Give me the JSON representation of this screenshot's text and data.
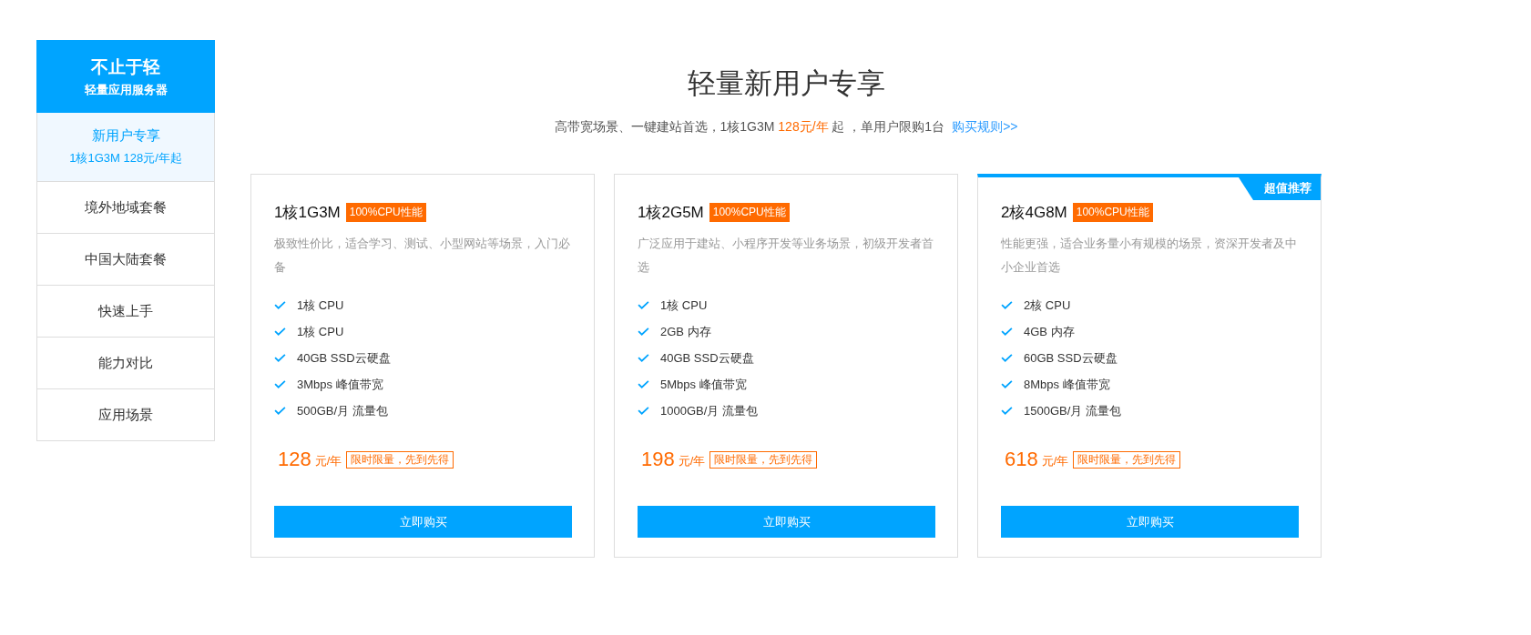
{
  "sidebar": {
    "title": "不止于轻",
    "subtitle": "轻量应用服务器",
    "items": [
      {
        "label": "新用户专享",
        "sub": "1核1G3M 128元/年起",
        "selected": true
      },
      {
        "label": "境外地域套餐",
        "selected": false
      },
      {
        "label": "中国大陆套餐",
        "selected": false
      },
      {
        "label": "快速上手",
        "selected": false
      },
      {
        "label": "能力对比",
        "selected": false
      },
      {
        "label": "应用场景",
        "selected": false
      }
    ]
  },
  "heading": "轻量新用户专享",
  "subtitle": {
    "before": "高带宽场景、一键建站首选，1核1G3M ",
    "highlight": "128元/年",
    "after": " 起 ，单用户限购1台",
    "link": "购买规则>>"
  },
  "plans": [
    {
      "name": "1核1G3M",
      "tag": "100%CPU性能",
      "desc": "极致性价比，适合学习、测试、小型网站等场景，入门必备",
      "features": [
        "1核 CPU",
        "1核 CPU",
        "40GB SSD云硬盘",
        "3Mbps 峰值带宽",
        "500GB/月 流量包"
      ],
      "price": "128",
      "unit": "元/年",
      "promo": "限时限量，先到先得",
      "button": "立即购买"
    },
    {
      "name": "1核2G5M",
      "tag": "100%CPU性能",
      "desc": "广泛应用于建站、小程序开发等业务场景，初级开发者首选",
      "features": [
        "1核 CPU",
        "2GB 内存",
        "40GB SSD云硬盘",
        "5Mbps 峰值带宽",
        "1000GB/月 流量包"
      ],
      "price": "198",
      "unit": "元/年",
      "promo": "限时限量，先到先得",
      "button": "立即购买"
    },
    {
      "name": "2核4G8M",
      "tag": "100%CPU性能",
      "desc": "性能更强，适合业务量小有规模的场景，资深开发者及中小企业首选",
      "features": [
        "2核 CPU",
        "4GB 内存",
        "60GB SSD云硬盘",
        "8Mbps 峰值带宽",
        "1500GB/月 流量包"
      ],
      "price": "618",
      "unit": "元/年",
      "promo": "限时限量，先到先得",
      "button": "立即购买",
      "ribbon": "超值推荐"
    }
  ]
}
